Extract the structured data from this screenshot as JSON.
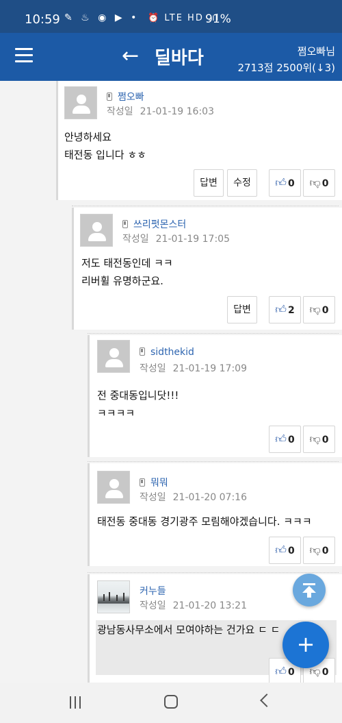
{
  "status_bar": {
    "time": "10:59",
    "left_icons": "✎ ♨ ◉ ▶ •",
    "right_icons": "⏰ LTE HD .ıl",
    "battery": "91%"
  },
  "app_bar": {
    "title": "딜바다",
    "user_name": "쩜오빠님",
    "user_stats": "2713점 2500위(↓3)"
  },
  "comments": [
    {
      "author": "쩜오빠",
      "date_label": "작성일",
      "date": "21-01-19 16:03",
      "lines": [
        "안녕하세요",
        "태전동 입니다 ㅎㅎ"
      ],
      "reply_label": "답변",
      "edit_label": "수정",
      "likes": "0",
      "dislikes": "0"
    },
    {
      "author": "쓰리펏몬스터",
      "date_label": "작성일",
      "date": "21-01-19 17:05",
      "lines": [
        "저도 태전동인데 ㅋㅋ",
        "리버휠 유명하군요."
      ],
      "reply_label": "답변",
      "likes": "2",
      "dislikes": "0"
    },
    {
      "author": "sidthekid",
      "date_label": "작성일",
      "date": "21-01-19 17:09",
      "lines": [
        "전 중대동입니닷!!!",
        "ㅋㅋㅋㅋ"
      ],
      "likes": "0",
      "dislikes": "0"
    },
    {
      "author": "뭐뭐",
      "date_label": "작성일",
      "date": "21-01-20 07:16",
      "lines": [
        "태전동 중대동 경기광주 모림해야겠습니다. ㅋㅋㅋ"
      ],
      "likes": "0",
      "dislikes": "0"
    },
    {
      "author": "커누들",
      "date_label": "작성일",
      "date": "21-01-20 13:21",
      "lines": [
        "광남동사무소에서 모여야하는 건가요 ㄷ ㄷ"
      ],
      "likes": "0",
      "dislikes": "0"
    }
  ],
  "icons": {
    "menu": "hamburger-icon",
    "back": "arrow-left-icon",
    "like": "thumbs-up-icon",
    "dislike": "thumbs-down-icon",
    "scroll_top": "arrow-up-to-line-icon",
    "add": "plus-icon"
  },
  "fab": {
    "add_label": "+"
  },
  "colors": {
    "app_bar": "#1c5aa6",
    "status_bar": "#1f4e86",
    "author": "#2e65b0",
    "fab_add": "#1c74d4",
    "fab_top": "#6aa8de"
  }
}
